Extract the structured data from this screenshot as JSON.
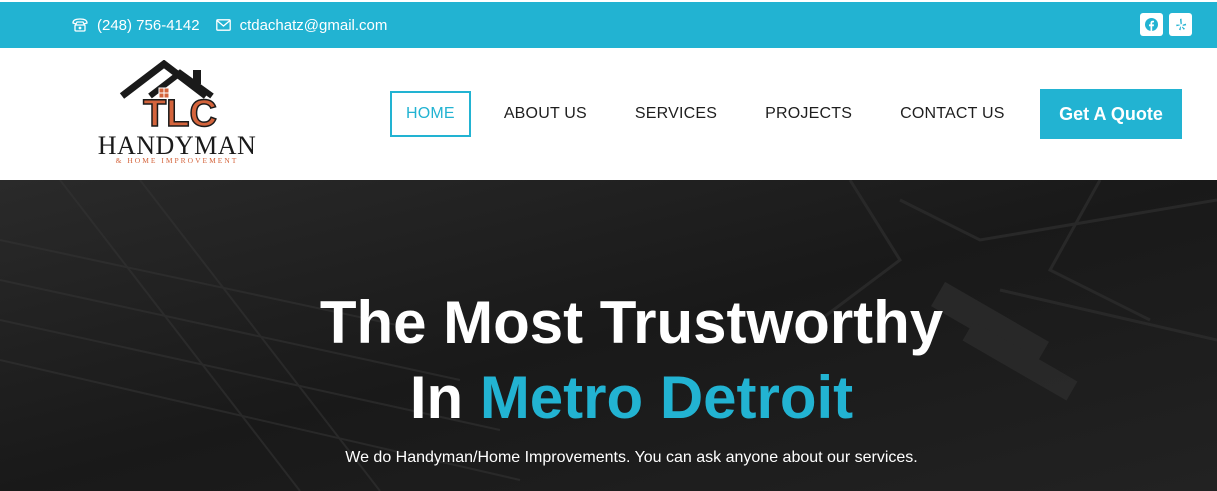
{
  "topbar": {
    "phone": "(248) 756-4142",
    "email": "ctdachatz@gmail.com",
    "social": [
      {
        "icon": "facebook-icon"
      },
      {
        "icon": "yelp-icon"
      }
    ]
  },
  "logo": {
    "letters": "TLC",
    "name": "HANDYMAN",
    "tagline": "& HOME IMPROVEMENT"
  },
  "nav": {
    "items": [
      {
        "label": "HOME",
        "active": true
      },
      {
        "label": "ABOUT US"
      },
      {
        "label": "SERVICES"
      },
      {
        "label": "PROJECTS"
      },
      {
        "label": "CONTACT US"
      }
    ],
    "cta": "Get A Quote"
  },
  "hero": {
    "line1": "The Most Trustworthy",
    "line2_prefix": "In",
    "line2_accent": "Metro Detroit",
    "subtitle": "We do Handyman/Home Improvements. You can ask anyone about our services."
  },
  "colors": {
    "accent": "#22b3d2",
    "logo_orange": "#d4643c",
    "hero_bg": "#1c1c1c"
  }
}
